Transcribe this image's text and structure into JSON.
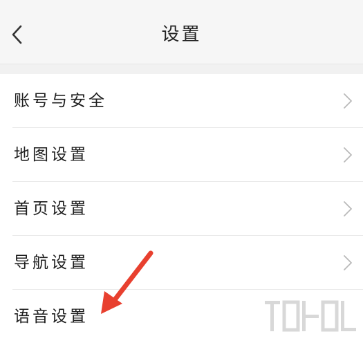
{
  "header": {
    "title": "设置",
    "back_icon": "chevron-left-icon"
  },
  "menu": {
    "items": [
      {
        "label": "账号与安全",
        "has_chevron": true
      },
      {
        "label": "地图设置",
        "has_chevron": true
      },
      {
        "label": "首页设置",
        "has_chevron": true
      },
      {
        "label": "导航设置",
        "has_chevron": true
      },
      {
        "label": "语音设置",
        "has_chevron": false
      }
    ]
  },
  "annotation": {
    "arrow_color": "#e8402f"
  }
}
